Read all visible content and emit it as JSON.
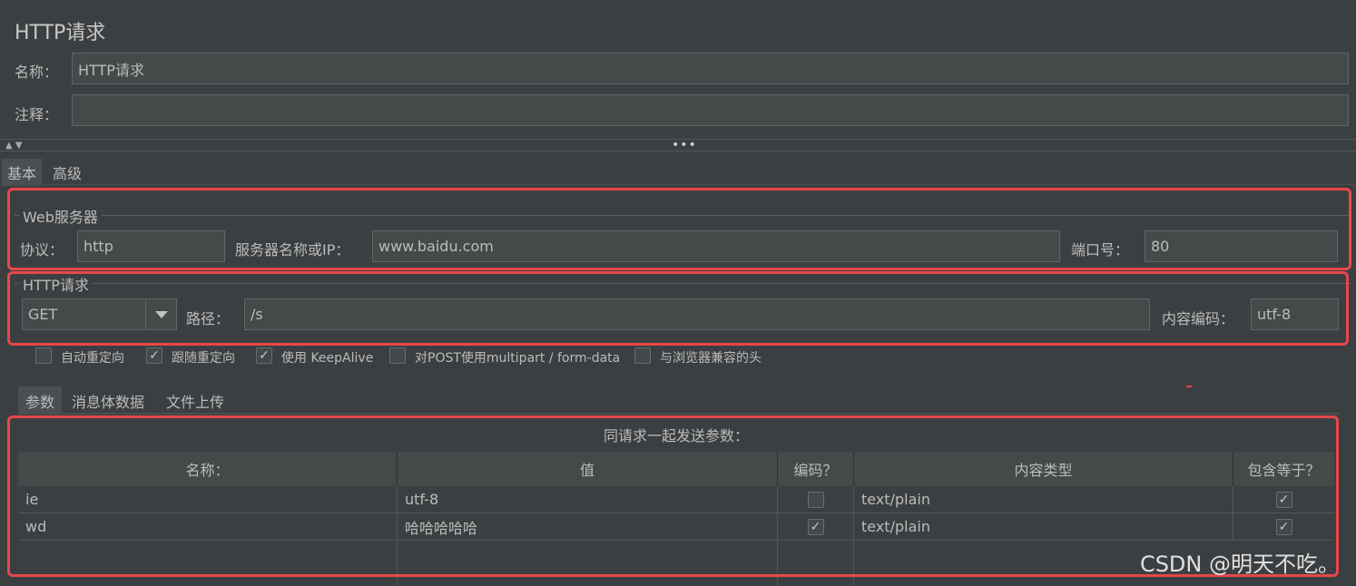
{
  "window": {
    "title": "HTTP请求"
  },
  "name_label": "名称：",
  "name_value": "HTTP请求",
  "comment_label": "注释：",
  "comment_value": "",
  "tabs": [
    {
      "label": "基本",
      "active": true
    },
    {
      "label": "高级",
      "active": false
    }
  ],
  "web_server": {
    "legend": "Web服务器",
    "protocol_label": "协议：",
    "protocol_value": "http",
    "server_label": "服务器名称或IP：",
    "server_value": "www.baidu.com",
    "port_label": "端口号：",
    "port_value": "80"
  },
  "http_request": {
    "legend": "HTTP请求",
    "method_value": "GET",
    "path_label": "路径：",
    "path_value": "/s",
    "encoding_label": "内容编码：",
    "encoding_value": "utf-8"
  },
  "options": [
    {
      "label": "自动重定向",
      "checked": false
    },
    {
      "label": "跟随重定向",
      "checked": true
    },
    {
      "label": "使用 KeepAlive",
      "checked": true
    },
    {
      "label": "对POST使用multipart / form-data",
      "checked": false
    },
    {
      "label": "与浏览器兼容的头",
      "checked": false
    }
  ],
  "sub_tabs": [
    {
      "label": "参数",
      "active": true
    },
    {
      "label": "消息体数据",
      "active": false
    },
    {
      "label": "文件上传",
      "active": false
    }
  ],
  "params": {
    "caption": "同请求一起发送参数：",
    "columns": [
      "名称：",
      "值",
      "编码？",
      "内容类型",
      "包含等于？"
    ],
    "rows": [
      {
        "name": "ie",
        "value": "utf-8",
        "encode": false,
        "content_type": "text/plain",
        "include_equals": true
      },
      {
        "name": "wd",
        "value": "哈哈哈哈哈",
        "encode": true,
        "content_type": "text/plain",
        "include_equals": true
      }
    ]
  },
  "watermark": "CSDN @明天不吃。",
  "colors": {
    "background": "#3c3f41",
    "field": "#45494a",
    "highlight": "#e8474b"
  }
}
